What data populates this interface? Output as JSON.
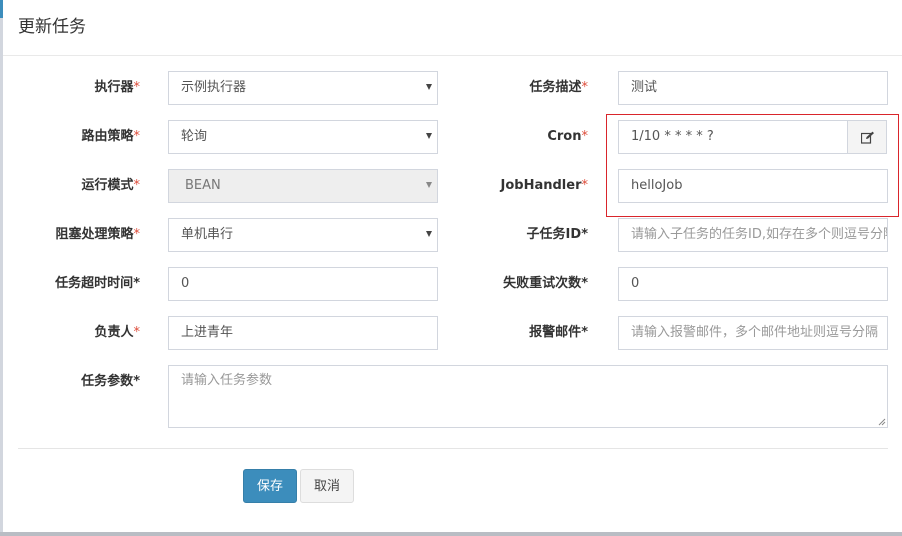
{
  "modal": {
    "title": "更新任务"
  },
  "form": {
    "executor": {
      "label": "执行器",
      "value": "示例执行器"
    },
    "description": {
      "label": "任务描述",
      "value": "测试"
    },
    "route_strategy": {
      "label": "路由策略",
      "value": "轮询"
    },
    "cron": {
      "label": "Cron",
      "value": "1/10 * * * * ?"
    },
    "run_mode": {
      "label": "运行模式",
      "value": "BEAN"
    },
    "job_handler": {
      "label": "JobHandler",
      "value": "helloJob"
    },
    "block_strategy": {
      "label": "阻塞处理策略",
      "value": "单机串行"
    },
    "child_job_id": {
      "label": "子任务ID",
      "placeholder": "请输入子任务的任务ID,如存在多个则逗号分隔"
    },
    "timeout": {
      "label": "任务超时时间",
      "value": "0"
    },
    "fail_retry": {
      "label": "失败重试次数",
      "value": "0"
    },
    "author": {
      "label": "负责人",
      "value": "上进青年"
    },
    "alarm_email": {
      "label": "报警邮件",
      "placeholder": "请输入报警邮件，多个邮件地址则逗号分隔"
    },
    "job_param": {
      "label": "任务参数",
      "placeholder": "请输入任务参数"
    },
    "required_mark": "*"
  },
  "footer": {
    "save_label": "保存",
    "cancel_label": "取消"
  },
  "colors": {
    "primary": "#3c8dbc",
    "required": "#dd4b39",
    "highlight_box": "#d9252b"
  },
  "icons": {
    "cron_edit": "edit-icon",
    "select": "caret-down-icon"
  }
}
